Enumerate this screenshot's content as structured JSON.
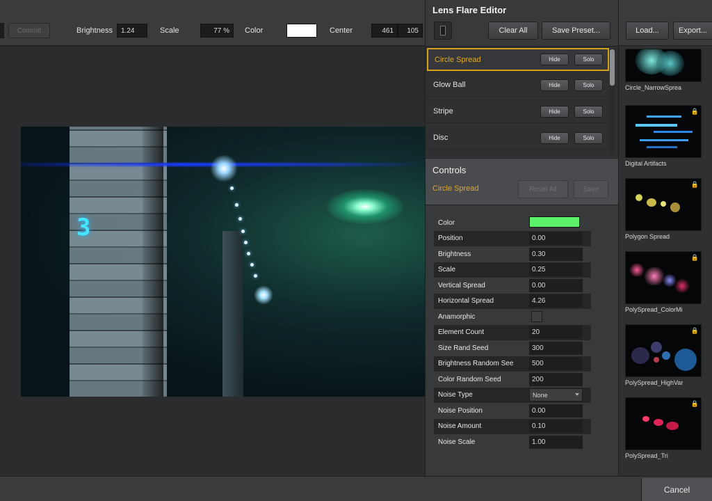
{
  "toolbar": {
    "left_button": "Commit",
    "brightness": {
      "label": "Brightness",
      "value": "1.24"
    },
    "scale": {
      "label": "Scale",
      "value": "77 %"
    },
    "color": {
      "label": "Color",
      "swatch": "#ffffff"
    },
    "center": {
      "label": "Center",
      "x": "461",
      "y": "105"
    }
  },
  "editor": {
    "title": "Lens Flare Editor",
    "clear_all": "Clear All",
    "save_preset": "Save Preset...",
    "layers": [
      {
        "name": "Circle Spread",
        "selected": true,
        "hide": "Hide",
        "solo": "Solo"
      },
      {
        "name": "Glow Ball",
        "selected": false,
        "hide": "Hide",
        "solo": "Solo"
      },
      {
        "name": "Stripe",
        "selected": false,
        "hide": "Hide",
        "solo": "Solo"
      },
      {
        "name": "Disc",
        "selected": false,
        "hide": "Hide",
        "solo": "Solo"
      }
    ],
    "controls": {
      "title": "Controls",
      "selected_layer": "Circle Spread",
      "reset_all": "Reset All",
      "save": "Save"
    },
    "properties": [
      {
        "label": "Color",
        "type": "color",
        "value": "#5cf26a"
      },
      {
        "label": "Position",
        "value": "0.00"
      },
      {
        "label": "Brightness",
        "value": "0.30"
      },
      {
        "label": "Scale",
        "value": "0.25"
      },
      {
        "label": "Vertical Spread",
        "value": "0.00"
      },
      {
        "label": "Horizontal Spread",
        "value": "4.26"
      },
      {
        "label": "Anamorphic",
        "type": "checkbox",
        "value": false
      },
      {
        "label": "Element Count",
        "value": "20"
      },
      {
        "label": "Size Rand Seed",
        "value": "300"
      },
      {
        "label": "Brightness Random See",
        "value": "500"
      },
      {
        "label": "Color Random Seed",
        "value": "200"
      },
      {
        "label": "Noise Type",
        "type": "select",
        "value": "None"
      },
      {
        "label": "Noise Position",
        "value": "0.00"
      },
      {
        "label": "Noise Amount",
        "value": "0.10"
      },
      {
        "label": "Noise Scale",
        "value": "1.00"
      }
    ]
  },
  "presets": {
    "load": "Load...",
    "export": "Export...",
    "items": [
      {
        "name": "Circle_NarrowSprea"
      },
      {
        "name": "Digital Artifacts"
      },
      {
        "name": "Polygon Spread"
      },
      {
        "name": "PolySpread_ColorMi"
      },
      {
        "name": "PolySpread_HighVar"
      },
      {
        "name": "PolySpread_Tri"
      }
    ]
  },
  "viewport": {
    "overlay_text": "3"
  },
  "footer": {
    "cancel": "Cancel"
  },
  "colors": {
    "accent": "#e0a92a",
    "panel": "#38393b",
    "background": "#2b2c2d"
  }
}
